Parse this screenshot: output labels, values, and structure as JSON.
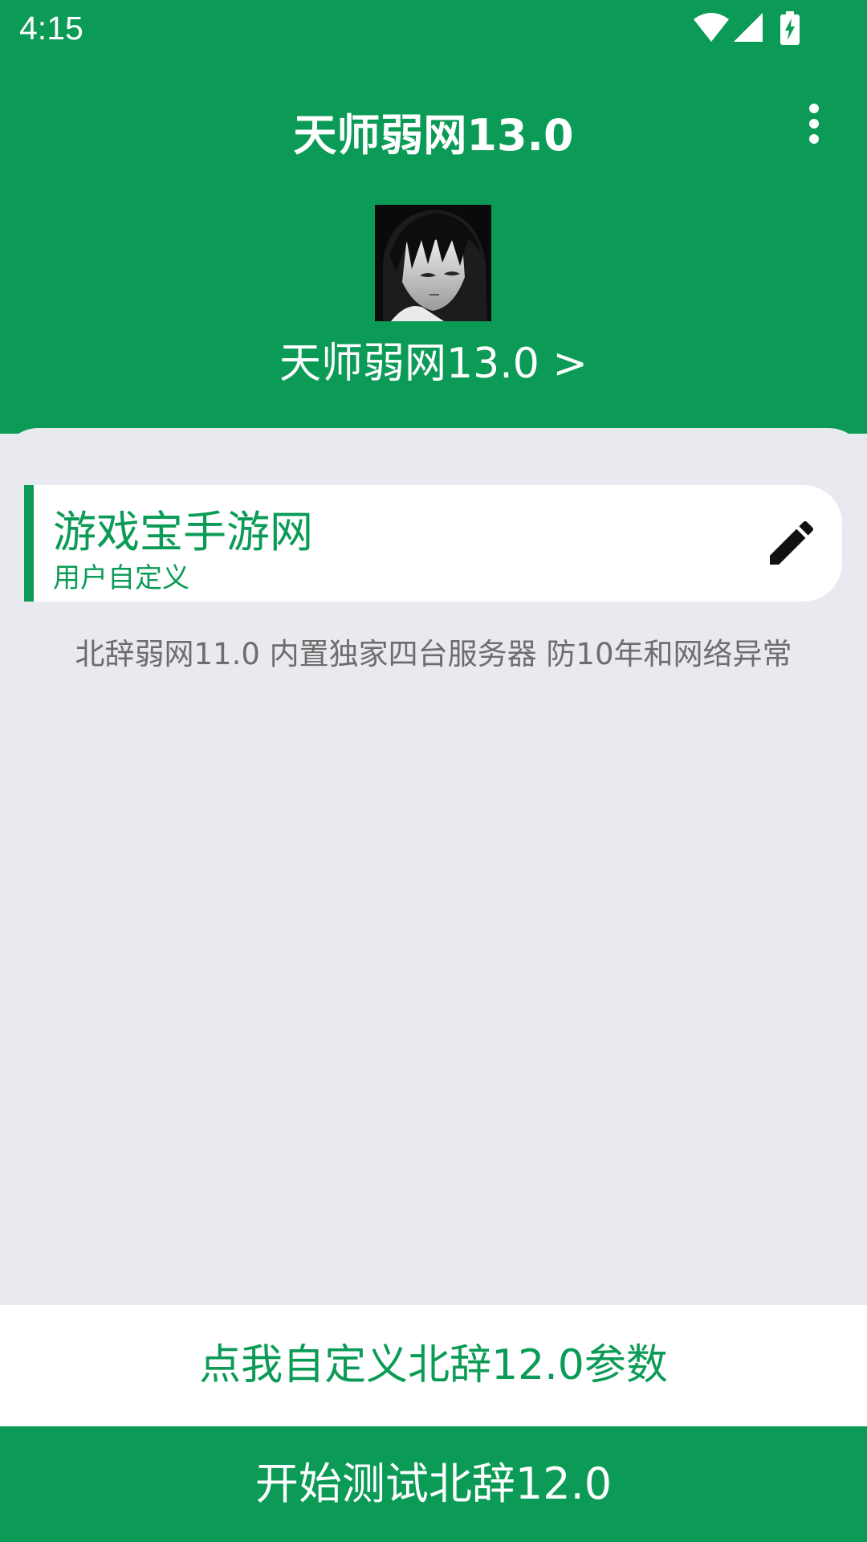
{
  "status_bar": {
    "time": "4:15",
    "icons": [
      "wifi-icon",
      "signal-icon",
      "battery-charging-icon"
    ]
  },
  "app_bar": {
    "title": "天师弱网13.0",
    "menu_icon": "more-vert-icon"
  },
  "profile": {
    "avatar": "anime-avatar",
    "name": "天师弱网13.0 >"
  },
  "mode_card": {
    "title": "游戏宝手游网",
    "subtitle": "用户自定义",
    "edit_icon": "edit-pencil-icon"
  },
  "description": "北辞弱网11.0 内置独家四台服务器 防10年和网络异常",
  "buttons": {
    "custom_label": "点我自定义北辞12.0参数",
    "start_label": "开始测试北辞12.0"
  },
  "colors": {
    "primary": "#0b9b56",
    "background": "#e9eaef",
    "card": "#ffffff",
    "muted_text": "#6d6d6d"
  }
}
